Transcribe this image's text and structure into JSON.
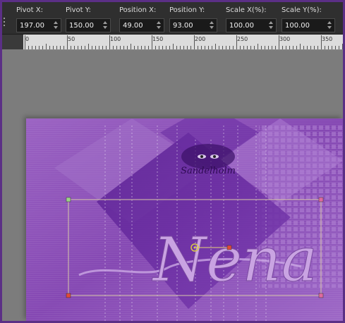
{
  "toolbar": {
    "fields": [
      {
        "label": "Pivot X:",
        "value": "197.00"
      },
      {
        "label": "Pivot Y:",
        "value": "150.00"
      },
      {
        "label": "Position X:",
        "value": "49.00"
      },
      {
        "label": "Position Y:",
        "value": "93.00"
      },
      {
        "label": "Scale X(%):",
        "value": "100.00"
      },
      {
        "label": "Scale Y(%):",
        "value": "100.00"
      }
    ]
  },
  "ruler": {
    "labels": [
      "0",
      "50",
      "100",
      "150",
      "200",
      "250",
      "300",
      "350"
    ]
  },
  "canvas": {
    "title_text": "Nena",
    "signature_text": "Sandelholm"
  },
  "colors": {
    "background": "#5b2f86",
    "workspace": "#7c7c7c",
    "toolbar": "#2f2f2f",
    "canvas_purple": "#8a4eb5",
    "selection_line": "#d8c8a8",
    "handle": "#e04a3a"
  }
}
